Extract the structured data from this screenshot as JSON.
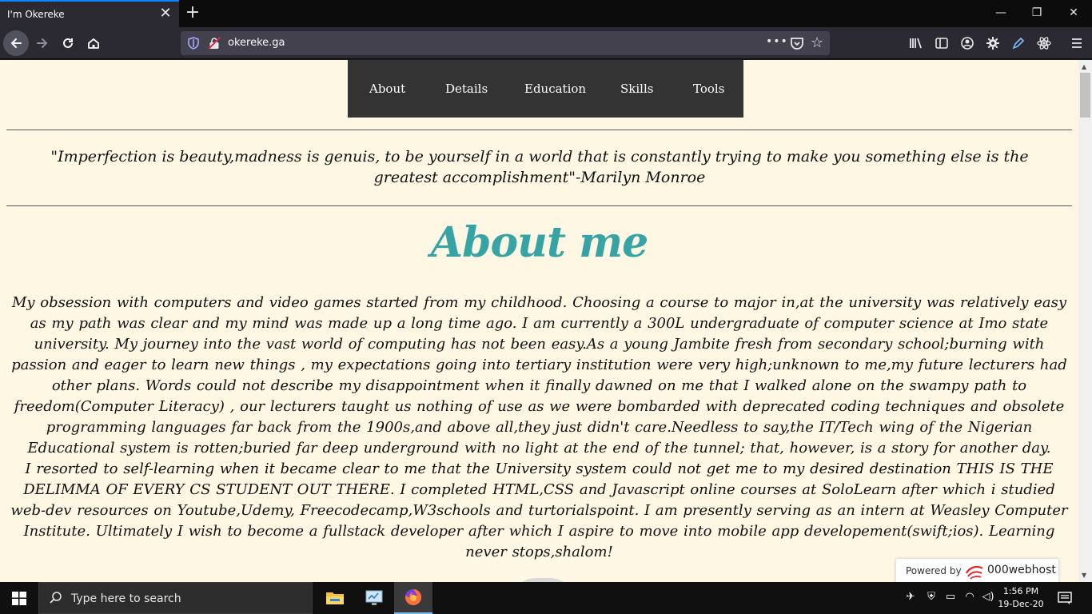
{
  "browser": {
    "tab_title": "I'm Okereke",
    "tab_close": "✕",
    "new_tab": "+",
    "window_controls": {
      "minimize": "—",
      "restore": "❐",
      "close": "✕"
    },
    "url": "okereke.ga",
    "url_actions": "•••",
    "toolbar_icons": [
      "library-icon",
      "sidebar-icon",
      "account-icon",
      "settings-gear-icon",
      "pen-icon",
      "react-devtools-icon",
      "menu-icon"
    ]
  },
  "site": {
    "nav": [
      "About",
      "Details",
      "Education",
      "Skills",
      "Tools"
    ],
    "quote": "\"Imperfection is beauty,madness is genuis, to be yourself in a world that is constantly trying to make you something else is the greatest accomplishment\"-Marilyn Monroe",
    "heading": "About me",
    "paragraph1": "My obsession with computers and video games started from my childhood. Choosing a course to major in,at the university was relatively easy as my path was clear and my mind was made up a long time ago. I am currently a 300L undergraduate of computer science at Imo state university. My journey into the vast world of computing has not been easy.As a young Jambite fresh from secondary school;burning with passion and eager to learn new things , my expectations going into tertiary institution were very high;unknown to me,my future lecturers had other plans. Words could not describe my disappointment when it finally dawned on me that I walked alone on the swampy path to freedom(Computer Literacy) , our lecturers taught us nothing of use as we were bombarded with deprecated coding techniques and obsolete programming languages far back from the 1900s,and above all,they just didn't care.Needless to say,the IT/Tech wing of the Nigerian Educational system is rotten;buried far deep underground with no light at the end of the tunnel; that, however, is a story for another day.",
    "paragraph2": "I resorted to self-learning when it became clear to me that the University system could not get me to my desired destination THIS IS THE DELIMMA OF EVERY CS STUDENT OUT THERE. I completed HTML,CSS and Javascript online courses at SoloLearn after which i studied web-dev resources on Youtube,Udemy, Freecodecamp,W3schools and turtorialspoint. I am presently serving as an intern at Weasley Computer Institute. Ultimately I wish to become a fullstack developer after which I aspire to move into mobile app developement(swift;ios). Learning never stops,shalom!",
    "powered_label": "Powered by",
    "powered_brand": "000webhost",
    "heading_color": "#36a3a4",
    "background_color": "#fdf7e3"
  },
  "taskbar": {
    "search_placeholder": "Type here to search",
    "time": "1:56 PM",
    "date": "19-Dec-20",
    "apps": [
      "file-explorer-icon",
      "control-panel-icon",
      "firefox-icon"
    ]
  }
}
